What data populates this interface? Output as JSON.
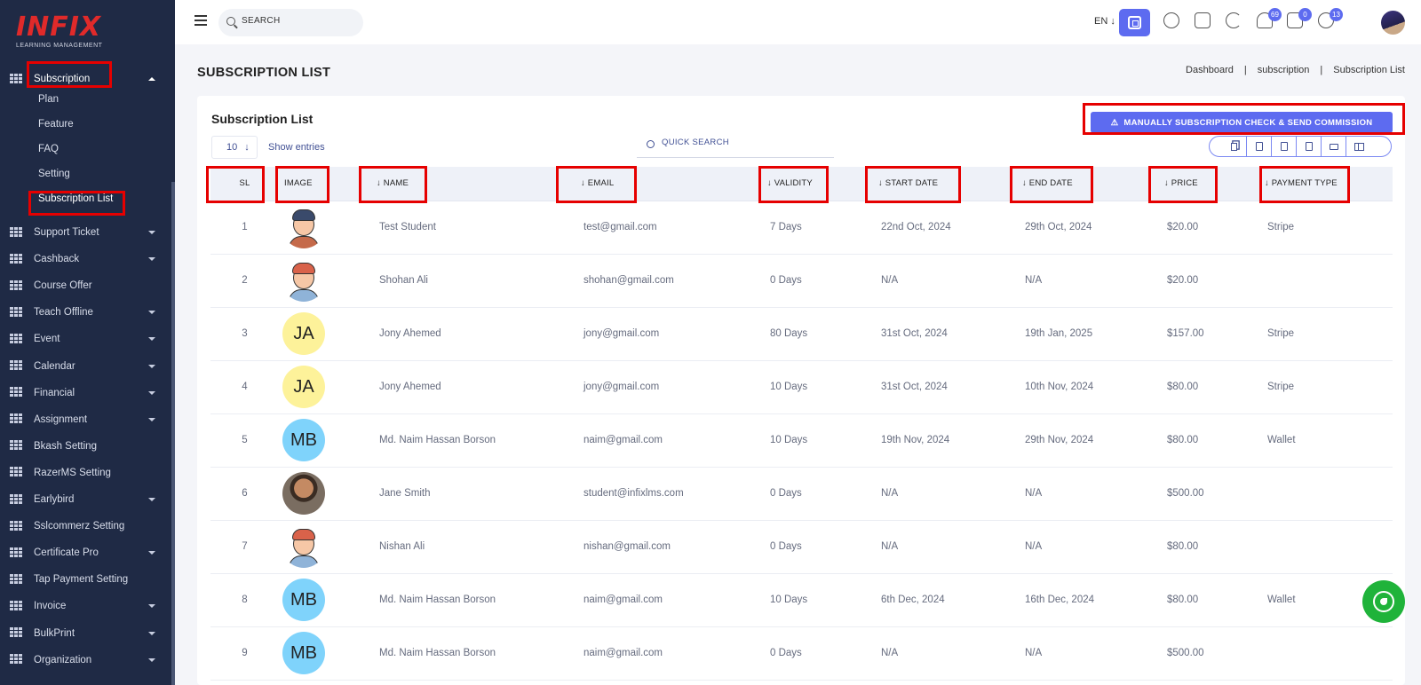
{
  "brand": {
    "logo_text": "INFIX",
    "logo_sub": "LEARNING MANAGEMENT"
  },
  "sidebar": {
    "active_group": {
      "label": "Subscription"
    },
    "sub_items": [
      "Plan",
      "Feature",
      "FAQ",
      "Setting",
      "Subscription List"
    ],
    "items": [
      {
        "label": "Support Ticket",
        "caret": true
      },
      {
        "label": "Cashback",
        "caret": true
      },
      {
        "label": "Course Offer",
        "caret": false
      },
      {
        "label": "Teach Offline",
        "caret": true
      },
      {
        "label": "Event",
        "caret": true
      },
      {
        "label": "Calendar",
        "caret": true
      },
      {
        "label": "Financial",
        "caret": true
      },
      {
        "label": "Assignment",
        "caret": true
      },
      {
        "label": "Bkash Setting",
        "caret": false
      },
      {
        "label": "RazerMS Setting",
        "caret": false
      },
      {
        "label": "Earlybird",
        "caret": true
      },
      {
        "label": "Sslcommerz Setting",
        "caret": false
      },
      {
        "label": "Certificate Pro",
        "caret": true
      },
      {
        "label": "Tap Payment Setting",
        "caret": false
      },
      {
        "label": "Invoice",
        "caret": true
      },
      {
        "label": "BulkPrint",
        "caret": true
      },
      {
        "label": "Organization",
        "caret": true
      }
    ]
  },
  "topbar": {
    "search_placeholder": "SEARCH",
    "language": "EN",
    "badges": {
      "notifications": "69",
      "messages": "0",
      "chat": "13"
    }
  },
  "page": {
    "title": "SUBSCRIPTION LIST",
    "breadcrumb": [
      "Dashboard",
      "subscription",
      "Subscription List"
    ],
    "card_title": "Subscription List",
    "primary_button": "MANUALLY SUBSCRIPTION CHECK & SEND COMMISSION",
    "entries_value": "10",
    "show_entries": "Show entries",
    "quick_search_placeholder": "QUICK SEARCH"
  },
  "table": {
    "columns": [
      "SL",
      "IMAGE",
      "NAME",
      "EMAIL",
      "VALIDITY",
      "START DATE",
      "END DATE",
      "PRICE",
      "PAYMENT TYPE"
    ],
    "rows": [
      {
        "sl": "1",
        "avatar": "cartoon-dark",
        "initials": "",
        "name": "Test Student",
        "email": "test@gmail.com",
        "validity": "7 Days",
        "start": "22nd Oct, 2024",
        "end": "29th Oct, 2024",
        "price": "$20.00",
        "payment": "Stripe"
      },
      {
        "sl": "2",
        "avatar": "cartoon-red",
        "initials": "",
        "name": "Shohan Ali",
        "email": "shohan@gmail.com",
        "validity": "0 Days",
        "start": "N/A",
        "end": "N/A",
        "price": "$20.00",
        "payment": ""
      },
      {
        "sl": "3",
        "avatar": "yellow",
        "initials": "JA",
        "name": "Jony Ahemed",
        "email": "jony@gmail.com",
        "validity": "80 Days",
        "start": "31st Oct, 2024",
        "end": "19th Jan, 2025",
        "price": "$157.00",
        "payment": "Stripe"
      },
      {
        "sl": "4",
        "avatar": "yellow",
        "initials": "JA",
        "name": "Jony Ahemed",
        "email": "jony@gmail.com",
        "validity": "10 Days",
        "start": "31st Oct, 2024",
        "end": "10th Nov, 2024",
        "price": "$80.00",
        "payment": "Stripe"
      },
      {
        "sl": "5",
        "avatar": "blue",
        "initials": "MB",
        "name": "Md. Naim Hassan Borson",
        "email": "naim@gmail.com",
        "validity": "10 Days",
        "start": "19th Nov, 2024",
        "end": "29th Nov, 2024",
        "price": "$80.00",
        "payment": "Wallet"
      },
      {
        "sl": "6",
        "avatar": "photo",
        "initials": "",
        "name": "Jane Smith",
        "email": "student@infixlms.com",
        "validity": "0 Days",
        "start": "N/A",
        "end": "N/A",
        "price": "$500.00",
        "payment": ""
      },
      {
        "sl": "7",
        "avatar": "cartoon-red",
        "initials": "",
        "name": "Nishan Ali",
        "email": "nishan@gmail.com",
        "validity": "0 Days",
        "start": "N/A",
        "end": "N/A",
        "price": "$80.00",
        "payment": ""
      },
      {
        "sl": "8",
        "avatar": "blue",
        "initials": "MB",
        "name": "Md. Naim Hassan Borson",
        "email": "naim@gmail.com",
        "validity": "10 Days",
        "start": "6th Dec, 2024",
        "end": "16th Dec, 2024",
        "price": "$80.00",
        "payment": "Wallet"
      },
      {
        "sl": "9",
        "avatar": "blue",
        "initials": "MB",
        "name": "Md. Naim Hassan Borson",
        "email": "naim@gmail.com",
        "validity": "0 Days",
        "start": "N/A",
        "end": "N/A",
        "price": "$500.00",
        "payment": ""
      }
    ]
  },
  "colors": {
    "sidebar_bg": "#1f2a45",
    "accent": "#5d6bf0",
    "highlight": "#e60000",
    "whatsapp": "#1fb33a"
  }
}
